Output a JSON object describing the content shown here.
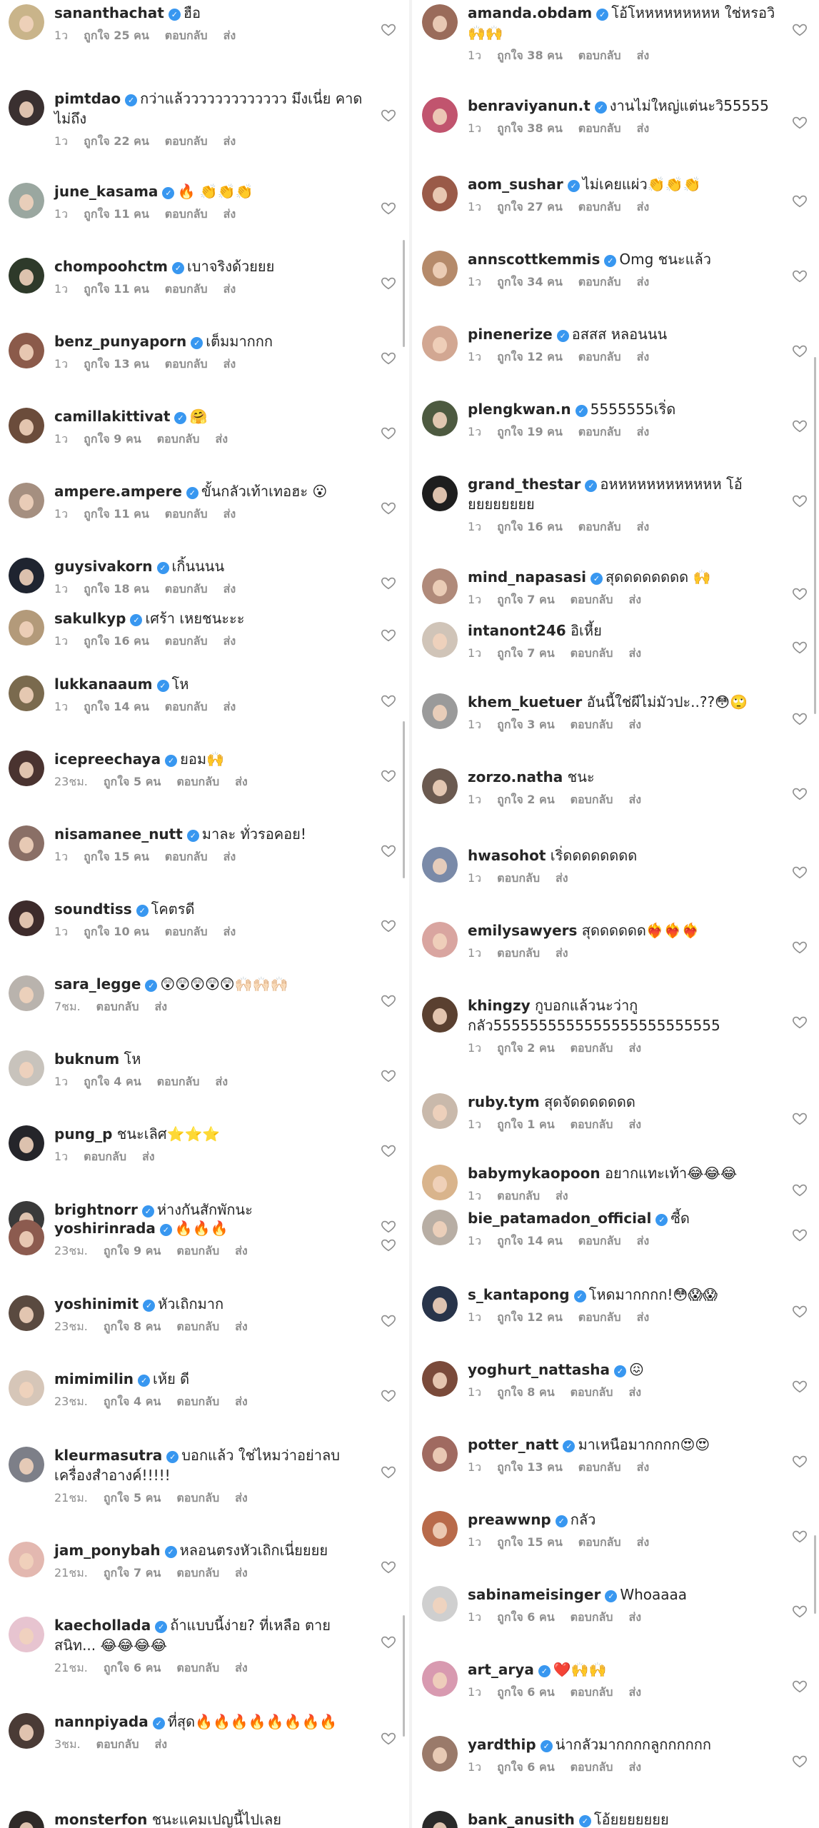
{
  "left_comments": [
    {
      "user": "sananthachat",
      "verified": true,
      "text": "ฮือ",
      "time": "1ว",
      "likes": "ถูกใจ 25 คน",
      "reply": "ตอบกลับ",
      "send": "ส่ง",
      "avatar": "#c9b48a"
    },
    {
      "user": "pimtdao",
      "verified": true,
      "text": "กว่าแล้ววววววววววววว มึงเนี่ย คาดไม่ถึง",
      "time": "1ว",
      "likes": "ถูกใจ 22 คน",
      "reply": "ตอบกลับ",
      "send": "ส่ง",
      "avatar": "#3a3030"
    },
    {
      "user": "june_kasama",
      "verified": true,
      "text": "🔥 👏👏👏",
      "time": "1ว",
      "likes": "ถูกใจ 11 คน",
      "reply": "ตอบกลับ",
      "send": "ส่ง",
      "avatar": "#9aa7a0"
    },
    {
      "user": "chompoohctm",
      "verified": true,
      "text": "เบาจริงด้วยยย",
      "time": "1ว",
      "likes": "ถูกใจ 11 คน",
      "reply": "ตอบกลับ",
      "send": "ส่ง",
      "avatar": "#2e3a2a"
    },
    {
      "user": "benz_punyaporn",
      "verified": true,
      "text": "เต็มมากกก",
      "time": "1ว",
      "likes": "ถูกใจ 13 คน",
      "reply": "ตอบกลับ",
      "send": "ส่ง",
      "avatar": "#8b5a4a"
    },
    {
      "user": "camillakittivat",
      "verified": true,
      "text": "🤗",
      "time": "1ว",
      "likes": "ถูกใจ 9 คน",
      "reply": "ตอบกลับ",
      "send": "ส่ง",
      "avatar": "#6b4c3b"
    },
    {
      "user": "ampere.ampere",
      "verified": true,
      "text": "ขั้นกลัวเท้าเทอฮะ 😮",
      "time": "1ว",
      "likes": "ถูกใจ 11 คน",
      "reply": "ตอบกลับ",
      "send": "ส่ง",
      "avatar": "#a58f80"
    },
    {
      "user": "guysivakorn",
      "verified": true,
      "text": "เกิ้นนนน",
      "time": "1ว",
      "likes": "ถูกใจ 18 คน",
      "reply": "ตอบกลับ",
      "send": "ส่ง",
      "avatar": "#1f2430"
    },
    {
      "user": "sakulkyp",
      "verified": true,
      "text": "เศร้า เหยชนะะะ",
      "time": "1ว",
      "likes": "ถูกใจ 16 คน",
      "reply": "ตอบกลับ",
      "send": "ส่ง",
      "avatar": "#b39a7a"
    },
    {
      "user": "lukkanaaum",
      "verified": true,
      "text": "โห",
      "time": "1ว",
      "likes": "ถูกใจ 14 คน",
      "reply": "ตอบกลับ",
      "send": "ส่ง",
      "avatar": "#7a6a4e"
    },
    {
      "user": "icepreechaya",
      "verified": true,
      "text": "ยอม🙌",
      "time": "23ชม.",
      "likes": "ถูกใจ 5 คน",
      "reply": "ตอบกลับ",
      "send": "ส่ง",
      "avatar": "#4a3330"
    },
    {
      "user": "nisamanee_nutt",
      "verified": true,
      "text": "มาละ ทั่วรอคอย!",
      "time": "1ว",
      "likes": "ถูกใจ 15 คน",
      "reply": "ตอบกลับ",
      "send": "ส่ง",
      "avatar": "#8a6f66"
    },
    {
      "user": "soundtiss",
      "verified": true,
      "text": "โคตรดี",
      "time": "1ว",
      "likes": "ถูกใจ 10 คน",
      "reply": "ตอบกลับ",
      "send": "ส่ง",
      "avatar": "#3d2b2b"
    },
    {
      "user": "sara_legge",
      "verified": true,
      "text": "😲😲😲😲😲🙌🏻🙌🏻🙌🏻",
      "time": "7ชม.",
      "likes": "",
      "reply": "ตอบกลับ",
      "send": "ส่ง",
      "avatar": "#b9b3ad"
    },
    {
      "user": "buknum",
      "verified": false,
      "text": "โห",
      "time": "1ว",
      "likes": "ถูกใจ 4 คน",
      "reply": "ตอบกลับ",
      "send": "ส่ง",
      "avatar": "#c8c3bc"
    },
    {
      "user": "pung_p",
      "verified": false,
      "text": "ชนะเลิศ⭐⭐⭐",
      "time": "1ว",
      "likes": "",
      "reply": "ตอบกลับ",
      "send": "ส่ง",
      "avatar": "#25252a"
    },
    {
      "user": "brightnorr",
      "verified": true,
      "text": "ห่างกันสักพักนะ",
      "time": "",
      "likes": "",
      "reply": "",
      "send": "",
      "avatar": "#3a3a3a"
    },
    {
      "user": "yoshirinrada",
      "verified": true,
      "text": "🔥🔥🔥",
      "time": "23ชม.",
      "likes": "ถูกใจ 9 คน",
      "reply": "ตอบกลับ",
      "send": "ส่ง",
      "avatar": "#8c5b4f"
    },
    {
      "user": "yoshinimit",
      "verified": true,
      "text": "หัวเถิกมาก",
      "time": "23ชม.",
      "likes": "ถูกใจ 8 คน",
      "reply": "ตอบกลับ",
      "send": "ส่ง",
      "avatar": "#5a4a40"
    },
    {
      "user": "mimimilin",
      "verified": true,
      "text": "เห้ย ดี",
      "time": "23ชม.",
      "likes": "ถูกใจ 4 คน",
      "reply": "ตอบกลับ",
      "send": "ส่ง",
      "avatar": "#d6c6b8"
    },
    {
      "user": "kleurmasutra",
      "verified": true,
      "text": "บอกแล้ว ใช่ไหมว่าอย่าลบเครื่องสำอางค์!!!!!",
      "time": "21ชม.",
      "likes": "ถูกใจ 5 คน",
      "reply": "ตอบกลับ",
      "send": "ส่ง",
      "avatar": "#7d7f88"
    },
    {
      "user": "jam_ponybah",
      "verified": true,
      "text": "หลอนตรงหัวเถิกเนี่ยยยย",
      "time": "21ชม.",
      "likes": "ถูกใจ 7 คน",
      "reply": "ตอบกลับ",
      "send": "ส่ง",
      "avatar": "#e3b8b0"
    },
    {
      "user": "kaechollada",
      "verified": true,
      "text": "ถ้าแบบนี้ง่าย? ที่เหลือ ตายสนิท... 😂😂😂😂",
      "time": "21ชม.",
      "likes": "ถูกใจ 6 คน",
      "reply": "ตอบกลับ",
      "send": "ส่ง",
      "avatar": "#e7c4d0"
    },
    {
      "user": "nannpiyada",
      "verified": true,
      "text": "ที่สุด🔥🔥🔥🔥🔥🔥🔥🔥",
      "time": "3ชม.",
      "likes": "",
      "reply": "ตอบกลับ",
      "send": "ส่ง",
      "avatar": "#4a3b36"
    },
    {
      "user": "monsterfon",
      "verified": false,
      "text": "ชนะแคมเปญนี้ไปเลย",
      "time": "",
      "likes": "",
      "reply": "",
      "send": "",
      "avatar": "#2f2a28"
    }
  ],
  "right_comments": [
    {
      "user": "amanda.obdam",
      "verified": true,
      "text": "โอ้โหหหหหหหหห ใช่หรอวิ 🙌🙌",
      "time": "1ว",
      "likes": "ถูกใจ 38 คน",
      "reply": "ตอบกลับ",
      "send": "ส่ง",
      "avatar": "#9a6b5a"
    },
    {
      "user": "benraviyanun.t",
      "verified": true,
      "text": "งานไม่ใหญ่แต่นะวิ55555",
      "time": "1ว",
      "likes": "ถูกใจ 38 คน",
      "reply": "ตอบกลับ",
      "send": "ส่ง",
      "avatar": "#c1546e"
    },
    {
      "user": "aom_sushar",
      "verified": true,
      "text": "ไม่เคยแผ่ว👏👏👏",
      "time": "1ว",
      "likes": "ถูกใจ 27 คน",
      "reply": "ตอบกลับ",
      "send": "ส่ง",
      "avatar": "#9a5a48"
    },
    {
      "user": "annscottkemmis",
      "verified": true,
      "text": "Omg ชนะแล้ว",
      "time": "1ว",
      "likes": "ถูกใจ 34 คน",
      "reply": "ตอบกลับ",
      "send": "ส่ง",
      "avatar": "#b58a6a"
    },
    {
      "user": "pinenerize",
      "verified": true,
      "text": "อสสส หลอนนน",
      "time": "1ว",
      "likes": "ถูกใจ 12 คน",
      "reply": "ตอบกลับ",
      "send": "ส่ง",
      "avatar": "#d2a792"
    },
    {
      "user": "plengkwan.n",
      "verified": true,
      "text": "5555555เริ่ด",
      "time": "1ว",
      "likes": "ถูกใจ 19 คน",
      "reply": "ตอบกลับ",
      "send": "ส่ง",
      "avatar": "#4d5a40"
    },
    {
      "user": "grand_thestar",
      "verified": true,
      "text": "อหหหหหหหหหหหห โอ้ยยยยยยยย",
      "time": "1ว",
      "likes": "ถูกใจ 16 คน",
      "reply": "ตอบกลับ",
      "send": "ส่ง",
      "avatar": "#1e1e1e"
    },
    {
      "user": "mind_napasasi",
      "verified": true,
      "text": "สุดดดดดดดด 🙌",
      "time": "1ว",
      "likes": "ถูกใจ 7 คน",
      "reply": "ตอบกลับ",
      "send": "ส่ง",
      "avatar": "#b08a7a"
    },
    {
      "user": "intanont246",
      "verified": false,
      "text": "อิเหี้ย",
      "time": "1ว",
      "likes": "ถูกใจ 7 คน",
      "reply": "ตอบกลับ",
      "send": "ส่ง",
      "avatar": "#d0c4b8"
    },
    {
      "user": "khem_kuetuer",
      "verified": false,
      "text": "อันนี้ใช่ผีไม่มัวปะ..??😳🙄",
      "time": "1ว",
      "likes": "ถูกใจ 3 คน",
      "reply": "ตอบกลับ",
      "send": "ส่ง",
      "avatar": "#9a9a9a"
    },
    {
      "user": "zorzo.natha",
      "verified": false,
      "text": "ชนะ",
      "time": "1ว",
      "likes": "ถูกใจ 2 คน",
      "reply": "ตอบกลับ",
      "send": "ส่ง",
      "avatar": "#6b5a50"
    },
    {
      "user": "hwasohot",
      "verified": false,
      "text": "เริ่ดดดดดดดด",
      "time": "1ว",
      "likes": "",
      "reply": "ตอบกลับ",
      "send": "ส่ง",
      "avatar": "#7a8aa8"
    },
    {
      "user": "emilysawyers",
      "verified": false,
      "text": "สุดดดดดด❤️‍🔥❤️‍🔥❤️‍🔥",
      "time": "1ว",
      "likes": "",
      "reply": "ตอบกลับ",
      "send": "ส่ง",
      "avatar": "#d9a5a0"
    },
    {
      "user": "khingzy",
      "verified": false,
      "text": "กูบอกแล้วนะว่ากูกลัว5555555555555555555555555",
      "time": "1ว",
      "likes": "ถูกใจ 2 คน",
      "reply": "ตอบกลับ",
      "send": "ส่ง",
      "avatar": "#5a4030"
    },
    {
      "user": "ruby.tym",
      "verified": false,
      "text": "สุดจัดดดดดดด",
      "time": "1ว",
      "likes": "ถูกใจ 1 คน",
      "reply": "ตอบกลับ",
      "send": "ส่ง",
      "avatar": "#c9b9ab"
    },
    {
      "user": "babymykaopoon",
      "verified": false,
      "text": "อยากแทะเท้า😂😂😂",
      "time": "1ว",
      "likes": "",
      "reply": "ตอบกลับ",
      "send": "ส่ง",
      "avatar": "#d9b48c"
    },
    {
      "user": "bie_patamadon_official",
      "verified": true,
      "text": "ซี้ด",
      "time": "1ว",
      "likes": "ถูกใจ 14 คน",
      "reply": "ตอบกลับ",
      "send": "ส่ง",
      "avatar": "#b8aea4"
    },
    {
      "user": "s_kantapong",
      "verified": true,
      "text": "โหดมากกกก!😳😱😱",
      "time": "1ว",
      "likes": "ถูกใจ 12 คน",
      "reply": "ตอบกลับ",
      "send": "ส่ง",
      "avatar": "#28344a"
    },
    {
      "user": "yoghurt_nattasha",
      "verified": true,
      "text": "😖",
      "time": "1ว",
      "likes": "ถูกใจ 8 คน",
      "reply": "ตอบกลับ",
      "send": "ส่ง",
      "avatar": "#7a4a3a"
    },
    {
      "user": "potter_natt",
      "verified": true,
      "text": "มาเหนือมากกกก😍😍",
      "time": "1ว",
      "likes": "ถูกใจ 13 คน",
      "reply": "ตอบกลับ",
      "send": "ส่ง",
      "avatar": "#a06a60"
    },
    {
      "user": "preawwnp",
      "verified": true,
      "text": "กลัว",
      "time": "1ว",
      "likes": "ถูกใจ 15 คน",
      "reply": "ตอบกลับ",
      "send": "ส่ง",
      "avatar": "#b86a4a"
    },
    {
      "user": "sabinameisinger",
      "verified": true,
      "text": "Whoaaaa",
      "time": "1ว",
      "likes": "ถูกใจ 6 คน",
      "reply": "ตอบกลับ",
      "send": "ส่ง",
      "avatar": "#cfcfcf"
    },
    {
      "user": "art_arya",
      "verified": true,
      "text": "❤️🙌🙌",
      "time": "1ว",
      "likes": "ถูกใจ 6 คน",
      "reply": "ตอบกลับ",
      "send": "ส่ง",
      "avatar": "#d89ab0"
    },
    {
      "user": "yardthip",
      "verified": true,
      "text": "น่ากลัวมากกกกลูกกกกกก",
      "time": "1ว",
      "likes": "ถูกใจ 6 คน",
      "reply": "ตอบกลับ",
      "send": "ส่ง",
      "avatar": "#9a7a6a"
    },
    {
      "user": "bank_anusith",
      "verified": true,
      "text": "โอ้ยยยยยยย",
      "time": "",
      "likes": "",
      "reply": "",
      "send": "",
      "avatar": "#2a2a2a"
    }
  ],
  "colors": {
    "verified": "#3897f0",
    "meta": "#8e8e8e",
    "text": "#262626"
  }
}
